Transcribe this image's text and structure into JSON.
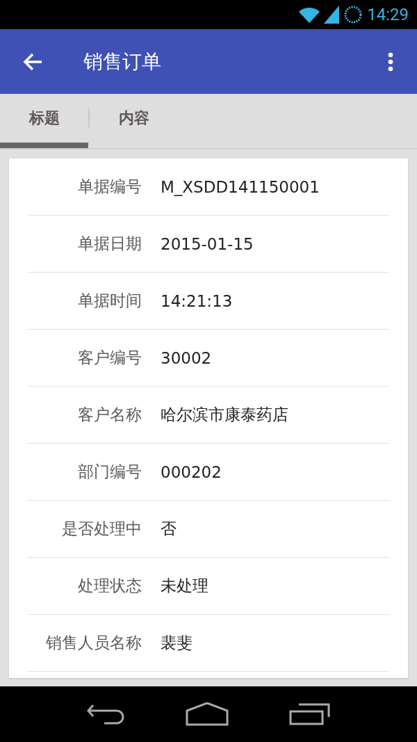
{
  "status_bar": {
    "time": "14:29"
  },
  "app_bar": {
    "title": "销售订单"
  },
  "tabs": [
    {
      "label": "标题",
      "selected": true
    },
    {
      "label": "内容",
      "selected": false
    }
  ],
  "fields": [
    {
      "label": "单据编号",
      "value": "M_XSDD141150001"
    },
    {
      "label": "单据日期",
      "value": "2015-01-15"
    },
    {
      "label": "单据时间",
      "value": "14:21:13"
    },
    {
      "label": "客户编号",
      "value": "30002"
    },
    {
      "label": "客户名称",
      "value": "哈尔滨市康泰药店"
    },
    {
      "label": "部门编号",
      "value": "000202"
    },
    {
      "label": "是否处理中",
      "value": "否"
    },
    {
      "label": "处理状态",
      "value": "未处理"
    },
    {
      "label": "销售人员名称",
      "value": "裴斐"
    }
  ]
}
